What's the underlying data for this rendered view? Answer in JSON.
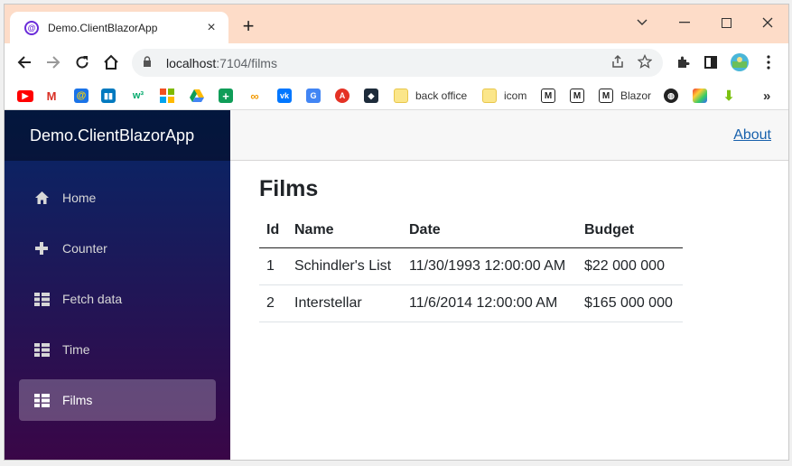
{
  "browser": {
    "tab_title": "Demo.ClientBlazorApp",
    "tab_close": "×",
    "new_tab": "+",
    "url_host": "localhost",
    "url_path": ":7104/films",
    "bookmarks": [
      {
        "icon": "youtube-icon",
        "label": ""
      },
      {
        "icon": "gmail-icon",
        "label": ""
      },
      {
        "icon": "at-icon",
        "label": ""
      },
      {
        "icon": "trello-icon",
        "label": ""
      },
      {
        "icon": "w3schools-icon",
        "label": ""
      },
      {
        "icon": "microsoft-icon",
        "label": ""
      },
      {
        "icon": "google-drive-icon",
        "label": ""
      },
      {
        "icon": "plus-app-icon",
        "label": ""
      },
      {
        "icon": "infinity-icon",
        "label": ""
      },
      {
        "icon": "vk-icon",
        "label": ""
      },
      {
        "icon": "translate-icon",
        "label": ""
      },
      {
        "icon": "aliexpress-icon",
        "label": ""
      },
      {
        "icon": "code-icon",
        "label": ""
      },
      {
        "icon": "folder-icon",
        "label": "back office"
      },
      {
        "icon": "folder-icon",
        "label": "icom"
      },
      {
        "icon": "m-icon",
        "label": ""
      },
      {
        "icon": "m-icon",
        "label": ""
      },
      {
        "icon": "m-icon",
        "label": "Blazor"
      },
      {
        "icon": "globe-icon",
        "label": ""
      },
      {
        "icon": "image-icon",
        "label": ""
      },
      {
        "icon": "download-icon",
        "label": ""
      }
    ],
    "more_bookmarks": "»"
  },
  "app": {
    "brand": "Demo.ClientBlazorApp",
    "about": "About",
    "nav": [
      {
        "label": "Home",
        "icon": "home-icon"
      },
      {
        "label": "Counter",
        "icon": "plus-icon"
      },
      {
        "label": "Fetch data",
        "icon": "list-icon"
      },
      {
        "label": "Time",
        "icon": "list-icon"
      },
      {
        "label": "Films",
        "icon": "list-icon",
        "active": true
      }
    ],
    "page_title": "Films",
    "table": {
      "headers": [
        "Id",
        "Name",
        "Date",
        "Budget"
      ],
      "rows": [
        [
          "1",
          "Schindler's List",
          "11/30/1993 12:00:00 AM",
          "$22 000 000"
        ],
        [
          "2",
          "Interstellar",
          "11/6/2014 12:00:00 AM",
          "$165 000 000"
        ]
      ]
    }
  },
  "colors": {
    "tabstrip": "#fddcc8",
    "sidebar_top": "#052767",
    "sidebar_bottom": "#3a0647",
    "link": "#1861ac"
  }
}
